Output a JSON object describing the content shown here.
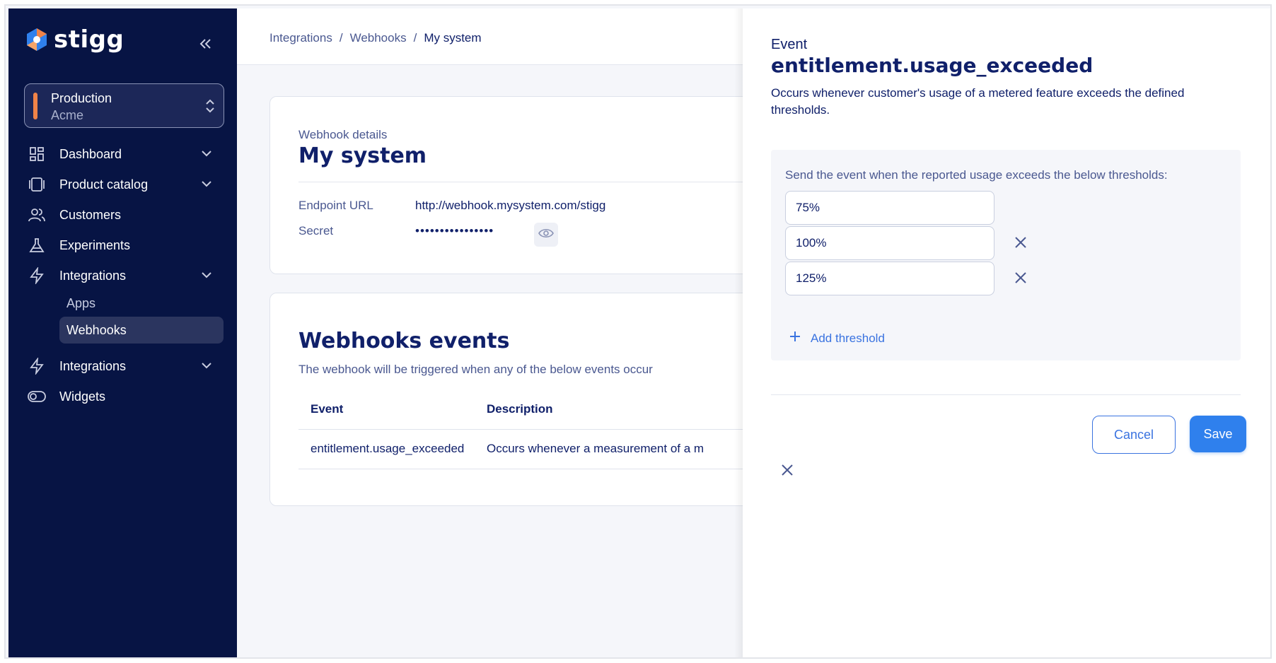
{
  "sidebar": {
    "brand": "stigg",
    "environment": {
      "name": "Production",
      "account": "Acme"
    },
    "items": [
      {
        "label": "Dashboard",
        "icon": "dashboard-icon"
      },
      {
        "label": "Product catalog",
        "icon": "catalog-icon"
      },
      {
        "label": "Customers",
        "icon": "customers-icon"
      },
      {
        "label": "Experiments",
        "icon": "flask-icon"
      },
      {
        "label": "Integrations",
        "icon": "bolt-icon"
      },
      {
        "label": "Integrations",
        "icon": "bolt-icon"
      },
      {
        "label": "Widgets",
        "icon": "toggle-icon"
      }
    ],
    "subitems": [
      "Apps",
      "Webhooks"
    ]
  },
  "breadcrumb": [
    "Integrations",
    "Webhooks",
    "My system"
  ],
  "details": {
    "kicker": "Webhook details",
    "title": "My system",
    "endpoint_label": "Endpoint URL",
    "endpoint_value": "http://webhook.mysystem.com/stigg",
    "secret_label": "Secret",
    "secret_value": "••••••••••••••••"
  },
  "events": {
    "title": "Webhooks events",
    "subtitle": "The webhook will be triggered when any of the below events occur",
    "columns": [
      "Event",
      "Description"
    ],
    "rows": [
      {
        "event": "entitlement.usage_exceeded",
        "description": "Occurs whenever a measurement of a m"
      }
    ]
  },
  "drawer": {
    "kicker": "Event",
    "title": "entitlement.usage_exceeded",
    "description": "Occurs whenever customer's usage of a metered feature exceeds the defined thresholds.",
    "panel_text": "Send the event when the reported usage exceeds the below thresholds:",
    "thresholds": [
      "75%",
      "100%",
      "125%"
    ],
    "add_label": "Add threshold",
    "cancel_label": "Cancel",
    "save_label": "Save"
  },
  "colors": {
    "sidebar": "#071444",
    "accent": "#2f80ed",
    "env_bar": "#f08348"
  }
}
